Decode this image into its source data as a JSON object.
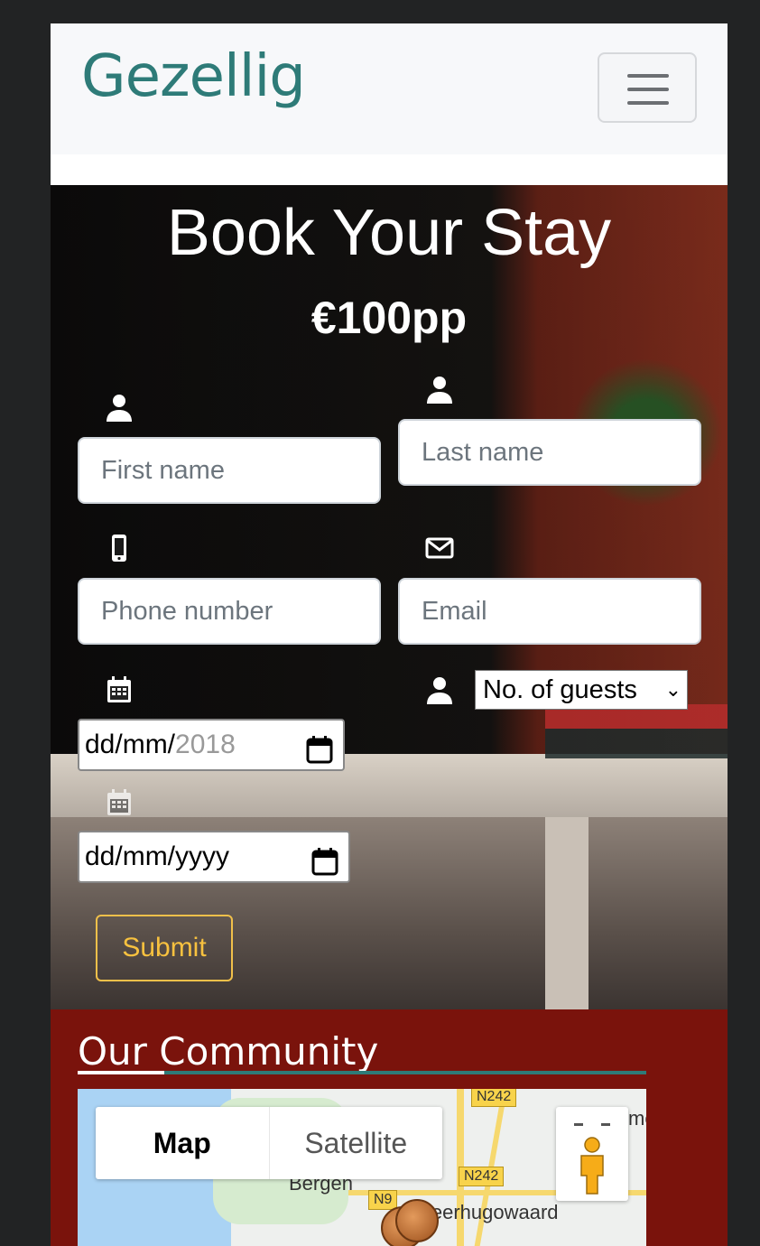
{
  "navbar": {
    "brand": "Gezellig",
    "toggle_icon": "hamburger-icon"
  },
  "booking": {
    "title": "Book Your Stay",
    "price": "€100pp",
    "first_name_placeholder": "First name",
    "last_name_placeholder": "Last name",
    "phone_placeholder": "Phone number",
    "email_placeholder": "Email",
    "guests_selected": "No. of guests",
    "checkin_value_prefix": "dd/mm/",
    "checkin_value_year": "2018",
    "checkout_value": "dd/mm/yyyy",
    "submit_label": "Submit",
    "icons": {
      "first_name": "user-icon",
      "last_name": "user-icon",
      "phone": "mobile-phone-icon",
      "email": "envelope-icon",
      "checkin": "calendar-icon",
      "guests": "user-icon",
      "checkout": "calendar-icon"
    }
  },
  "community": {
    "title": "Our Community",
    "map": {
      "map_button": "Map",
      "satellite_button": "Satellite",
      "labels": {
        "bergen": "Bergen",
        "heerhugowaard": "Heerhugowaard",
        "partial_town": "me"
      },
      "road_badges": [
        "N242",
        "N242",
        "N9"
      ]
    }
  },
  "colors": {
    "brand_teal": "#2e7b78",
    "submit_yellow": "#f7c13f",
    "community_red": "#7a130c"
  }
}
